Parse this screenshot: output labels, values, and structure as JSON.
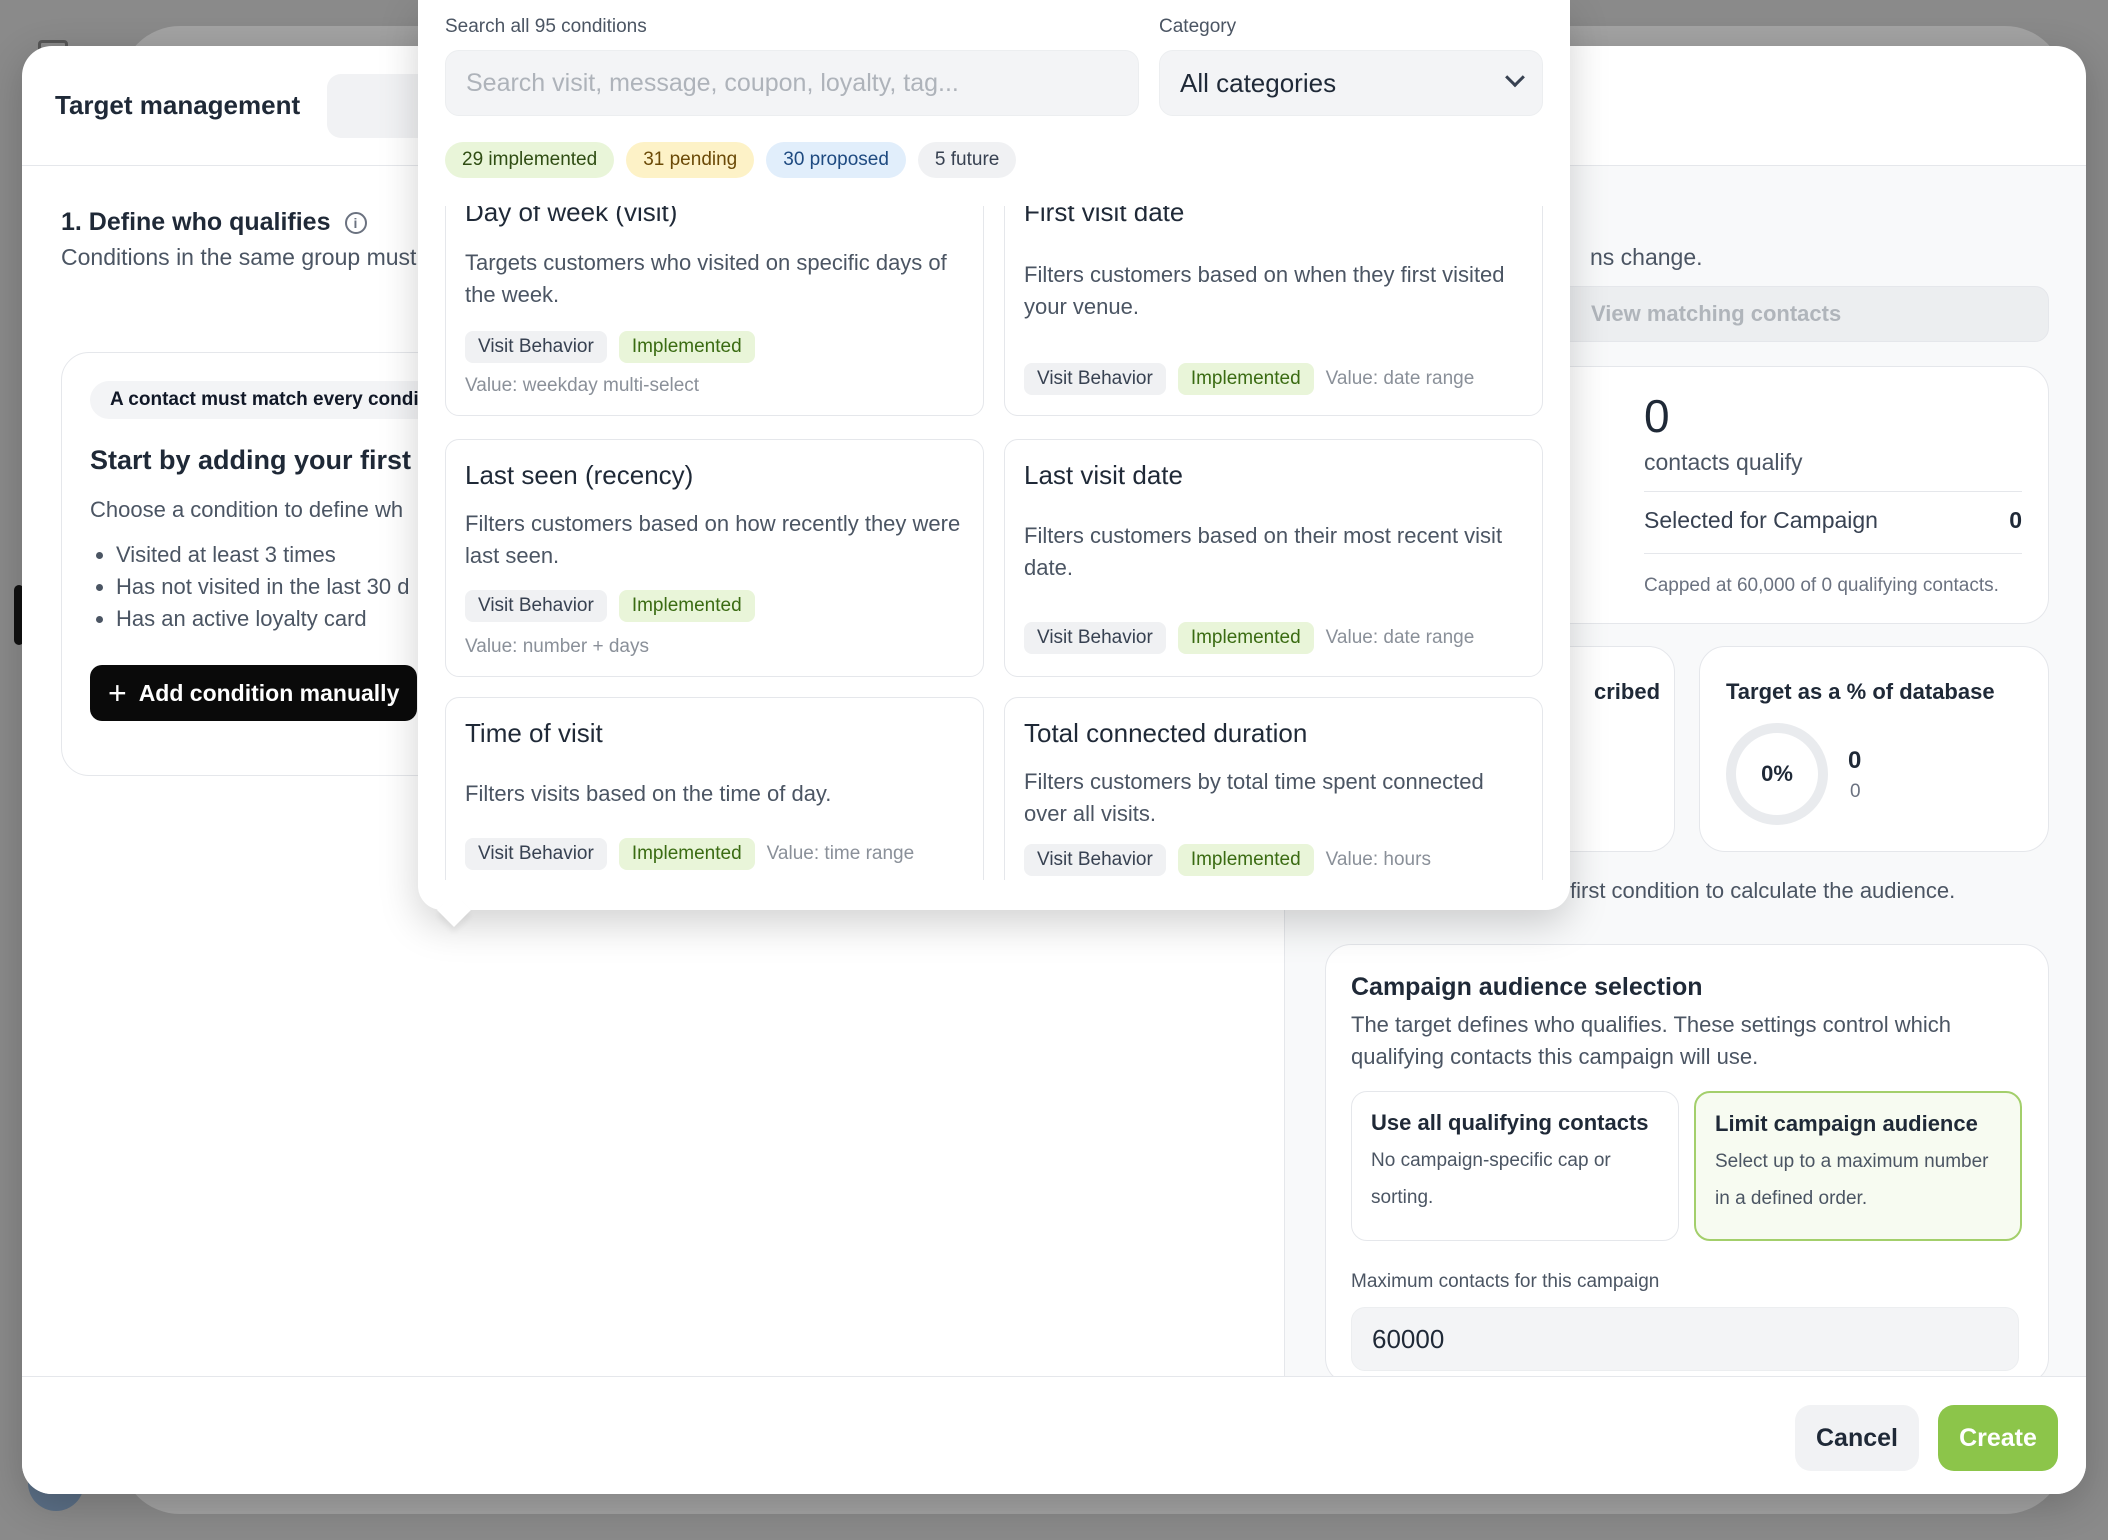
{
  "modal": {
    "title": "Target management"
  },
  "left": {
    "section_title": "1. Define who qualifies",
    "section_sub": "Conditions in the same group must",
    "match_pill": "A contact must match every condit",
    "start_title": "Start by adding your first co",
    "start_sub": "Choose a condition to define wh",
    "examples": [
      "Visited at least 3 times",
      "Has not visited in the last 30 d",
      "Has an active loyalty card"
    ],
    "add_button": "Add condition manually"
  },
  "right": {
    "changes_text": "ns change.",
    "view_button": "View matching contacts",
    "qualify_count": "0",
    "qualify_label": "contacts qualify",
    "selected_label": "Selected for Campaign",
    "selected_value": "0",
    "cap_text": "Capped at 60,000 of 0 qualifying contacts.",
    "mini_a_title": "cribed",
    "mini_b_title": "Target as a % of database",
    "ring_percent": "0%",
    "ring_num": "0",
    "ring_sub": "0",
    "hint": "first condition to calculate the audience.",
    "audience": {
      "title": "Campaign audience selection",
      "desc": "The target defines who qualifies. These settings control which qualifying contacts this campaign will use.",
      "opt_all_title": "Use all qualifying contacts",
      "opt_all_desc": "No campaign-specific cap or sorting.",
      "opt_limit_title": "Limit campaign audience",
      "opt_limit_desc": "Select up to a maximum number in a defined order.",
      "max_label": "Maximum contacts for this campaign",
      "max_value": "60000"
    }
  },
  "footer": {
    "cancel": "Cancel",
    "create": "Create"
  },
  "picker": {
    "search_label": "Search all 95 conditions",
    "search_placeholder": "Search visit, message, coupon, loyalty, tag...",
    "category_label": "Category",
    "category_value": "All categories",
    "chips": {
      "implemented": "29 implemented",
      "pending": "31 pending",
      "proposed": "30 proposed",
      "future": "5 future"
    },
    "conditions": [
      {
        "title": "Day of week (visit)",
        "desc": "Targets customers who visited on specific days of the week.",
        "category": "Visit Behavior",
        "status": "Implemented",
        "value": "Value: weekday multi-select"
      },
      {
        "title": "First visit date",
        "desc": "Filters customers based on when they first visited your venue.",
        "category": "Visit Behavior",
        "status": "Implemented",
        "value": "Value: date range"
      },
      {
        "title": "Last seen (recency)",
        "desc": "Filters customers based on how recently they were last seen.",
        "category": "Visit Behavior",
        "status": "Implemented",
        "value": "Value: number + days"
      },
      {
        "title": "Last visit date",
        "desc": "Filters customers based on their most recent visit date.",
        "category": "Visit Behavior",
        "status": "Implemented",
        "value": "Value: date range"
      },
      {
        "title": "Time of visit",
        "desc": "Filters visits based on the time of day.",
        "category": "Visit Behavior",
        "status": "Implemented",
        "value": "Value: time range"
      },
      {
        "title": "Total connected duration",
        "desc": "Filters customers by total time spent connected over all visits.",
        "category": "Visit Behavior",
        "status": "Implemented",
        "value": "Value: hours"
      }
    ]
  },
  "colors": {
    "accent_green": "#8cc54a",
    "implemented_bg": "#e9f5d9",
    "pending_bg": "#fdf2c7",
    "proposed_bg": "#e1eefb"
  }
}
